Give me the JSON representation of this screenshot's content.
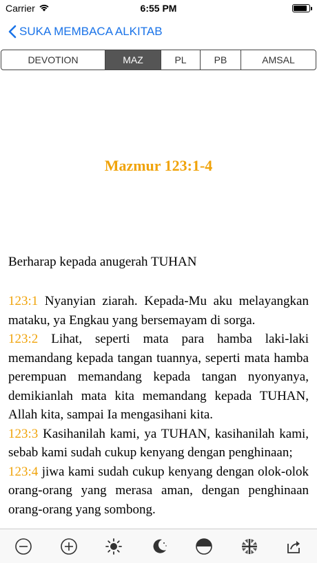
{
  "status_bar": {
    "carrier": "Carrier",
    "time": "6:55 PM",
    "battery_level": 0.85
  },
  "nav": {
    "back_label": "SUKA MEMBACA ALKITAB"
  },
  "tabs": [
    {
      "label": "DEVOTION",
      "active": false
    },
    {
      "label": "MAZ",
      "active": true
    },
    {
      "label": "PL",
      "active": false
    },
    {
      "label": "PB",
      "active": false
    },
    {
      "label": "AMSAL",
      "active": false
    }
  ],
  "passage": {
    "title": "Mazmur 123:1-4",
    "heading": "Berharap kepada anugerah TUHAN",
    "verses": [
      {
        "num": "123:1",
        "text": " Nyanyian ziarah. Kepada-Mu aku melayangkan mataku, ya Engkau yang bersemayam di sorga."
      },
      {
        "num": "123:2",
        "text": " Lihat, seperti mata para hamba laki-laki memandang kepada tangan tuannya, seperti mata hamba perempuan memandang kepada tangan nyonyanya, demikianlah mata kita memandang kepada TUHAN, Allah kita, sampai Ia mengasihani kita."
      },
      {
        "num": "123:3",
        "text": " Kasihanilah kami, ya TUHAN, kasihanilah kami, sebab kami sudah cukup kenyang dengan penghinaan;"
      },
      {
        "num": "123:4",
        "text": " jiwa kami sudah cukup kenyang dengan olok-olok orang-orang yang merasa aman, dengan penghinaan orang-orang yang sombong."
      }
    ]
  },
  "toolbar": {
    "icons": [
      "zoom-out-icon",
      "zoom-in-icon",
      "brightness-icon",
      "night-mode-icon",
      "contrast-icon",
      "language-flag-icon",
      "share-icon"
    ]
  },
  "colors": {
    "accent": "#1a73e8",
    "verse_number": "#f0a30a",
    "active_tab": "#555555"
  }
}
